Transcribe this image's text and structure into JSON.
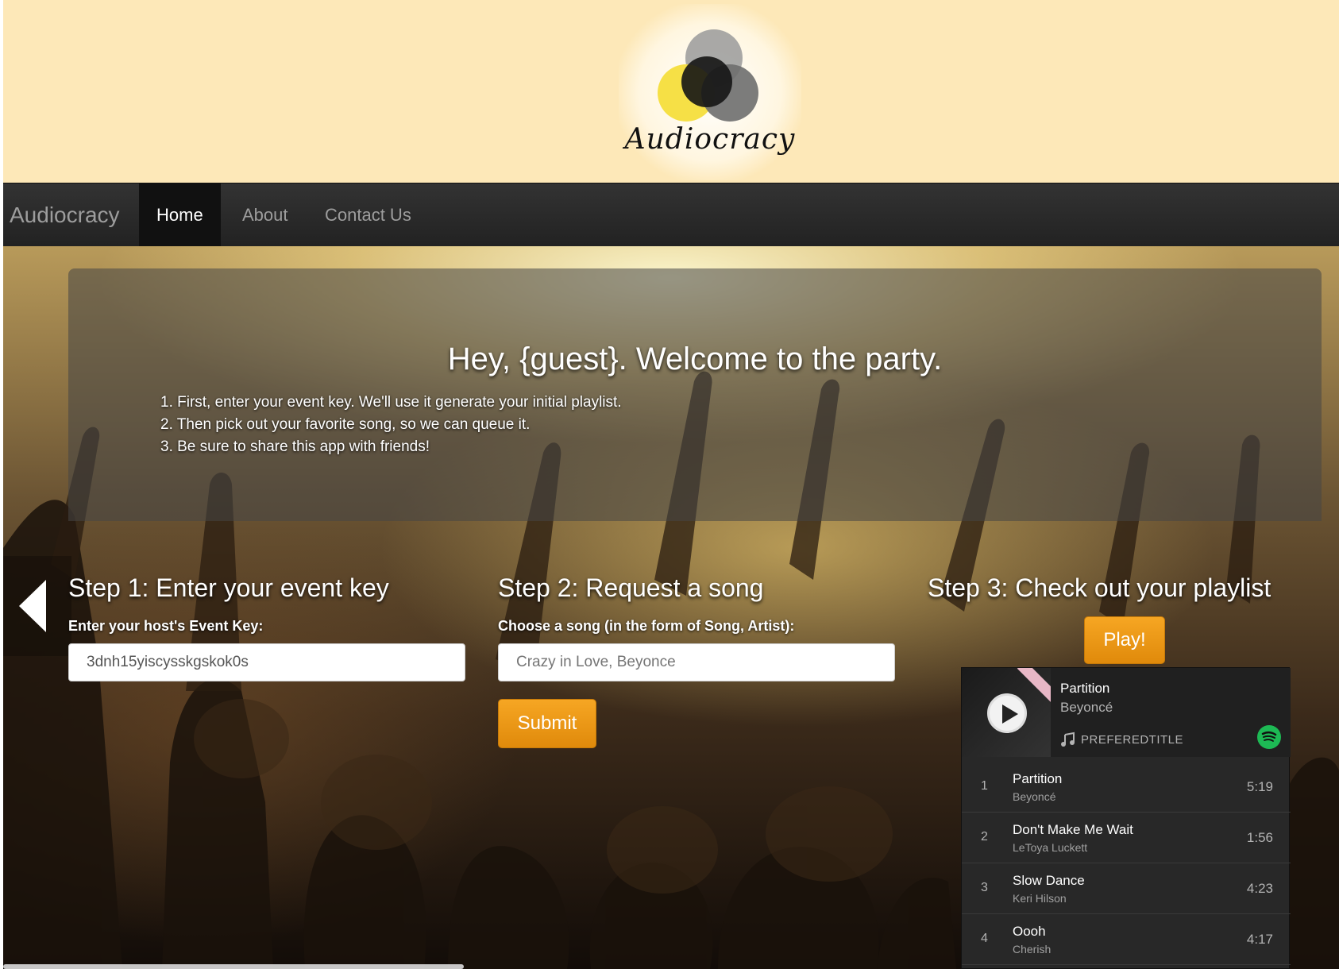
{
  "header": {
    "logo_text": "Audiocracy",
    "logo_icon": "overlapping-circles-logo",
    "colors": {
      "background": "#fde8b8",
      "circle_yellow": "#f5de3c",
      "circle_dark": "#1a1a1a",
      "circle_grey": "#8c8c8c"
    }
  },
  "navbar": {
    "brand": "Audiocracy",
    "items": [
      {
        "label": "Home",
        "active": true
      },
      {
        "label": "About",
        "active": false
      },
      {
        "label": "Contact Us",
        "active": false
      }
    ]
  },
  "jumbotron": {
    "title": "Hey, {guest}. Welcome to the party.",
    "steps": [
      "1. First, enter your event key. We'll use it generate your initial playlist.",
      "2. Then pick out your favorite song, so we can queue it.",
      "3. Be sure to share this app with friends!"
    ]
  },
  "carousel": {
    "prev_icon": "chevron-left-icon"
  },
  "step1": {
    "title": "Step 1: Enter your event key",
    "label": "Enter your host's Event Key:",
    "input_value": "3dnh15yiscysskgskok0s"
  },
  "step2": {
    "title": "Step 2: Request a song",
    "label": "Choose a song (in the form of Song, Artist):",
    "input_placeholder": "Crazy in Love, Beyonce",
    "submit_label": "Submit"
  },
  "step3": {
    "title": "Step 3: Check out your playlist",
    "play_label": "Play!"
  },
  "player": {
    "now_playing_title": "Partition",
    "now_playing_artist": "Beyoncé",
    "playlist_name": "PREFEREDTITLE",
    "icons": {
      "play": "play-icon",
      "note": "music-note-icon",
      "brand": "spotify-icon"
    },
    "tracks": [
      {
        "num": "1",
        "name": "Partition",
        "artist": "Beyoncé",
        "duration": "5:19"
      },
      {
        "num": "2",
        "name": "Don't Make Me Wait",
        "artist": "LeToya Luckett",
        "duration": "1:56"
      },
      {
        "num": "3",
        "name": "Slow Dance",
        "artist": "Keri Hilson",
        "duration": "4:23"
      },
      {
        "num": "4",
        "name": "Oooh",
        "artist": "Cherish",
        "duration": "4:17"
      }
    ]
  },
  "colors": {
    "accent_orange": "#f0961a",
    "navbar": "#222222",
    "spotify_green": "#1db954"
  }
}
